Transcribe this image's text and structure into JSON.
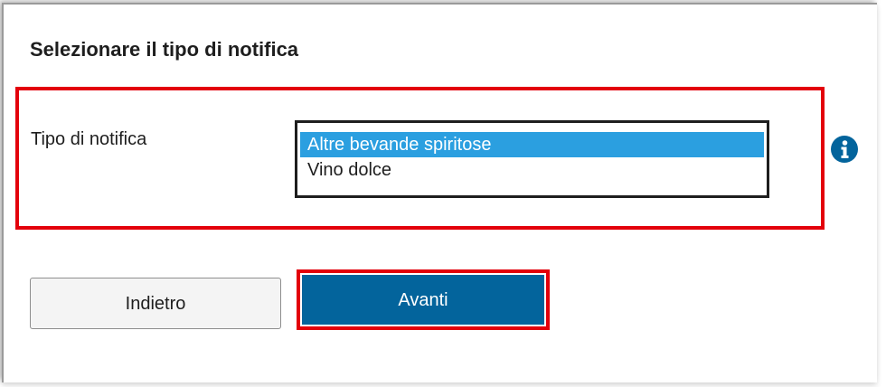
{
  "form": {
    "heading": "Selezionare il tipo di notifica",
    "field_label": "Tipo di notifica",
    "options": [
      {
        "label": "Altre bevande spiritose",
        "selected": true
      },
      {
        "label": "Vino dolce",
        "selected": false
      }
    ],
    "info_icon": "info-icon"
  },
  "buttons": {
    "back_label": "Indietro",
    "next_label": "Avanti"
  },
  "colors": {
    "highlight": "#e3000b",
    "selected_option": "#2b9fe0",
    "primary_button": "#03649c",
    "info_icon": "#03649c"
  }
}
